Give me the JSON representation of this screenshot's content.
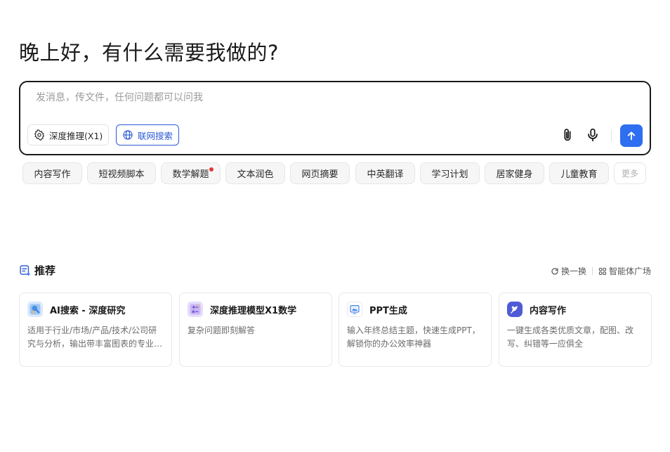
{
  "greeting": "晚上好，有什么需要我做的?",
  "composer": {
    "placeholder": "发消息，传文件，任何问题都可以问我",
    "reasoning_label": "深度推理(X1)",
    "web_search_label": "联网搜索",
    "accent": "#2e6ef0"
  },
  "quick_actions": [
    {
      "label": "内容写作"
    },
    {
      "label": "短视频脚本"
    },
    {
      "label": "数学解题",
      "badge": true
    },
    {
      "label": "文本润色"
    },
    {
      "label": "网页摘要"
    },
    {
      "label": "中英翻译"
    },
    {
      "label": "学习计划"
    },
    {
      "label": "居家健身"
    },
    {
      "label": "儿童教育"
    }
  ],
  "more_label": "更多",
  "recommend": {
    "title": "推荐",
    "refresh_label": "换一换",
    "plaza_label": "智能体广场",
    "cards": [
      {
        "title": "AI搜索 - 深度研究",
        "desc": "适用于行业/市场/产品/技术/公司研究与分析，输出带丰富图表的专业报告",
        "icon": "research-icon"
      },
      {
        "title": "深度推理模型X1数学",
        "desc": "复杂问题即刻解答",
        "icon": "math-icon"
      },
      {
        "title": "PPT生成",
        "desc": "输入年终总结主题，快速生成PPT，解锁你的办公效率神器",
        "icon": "ppt-icon"
      },
      {
        "title": "内容写作",
        "desc": "一键生成各类优质文章，配图、改写、纠错等一应俱全",
        "icon": "writing-icon"
      }
    ]
  }
}
